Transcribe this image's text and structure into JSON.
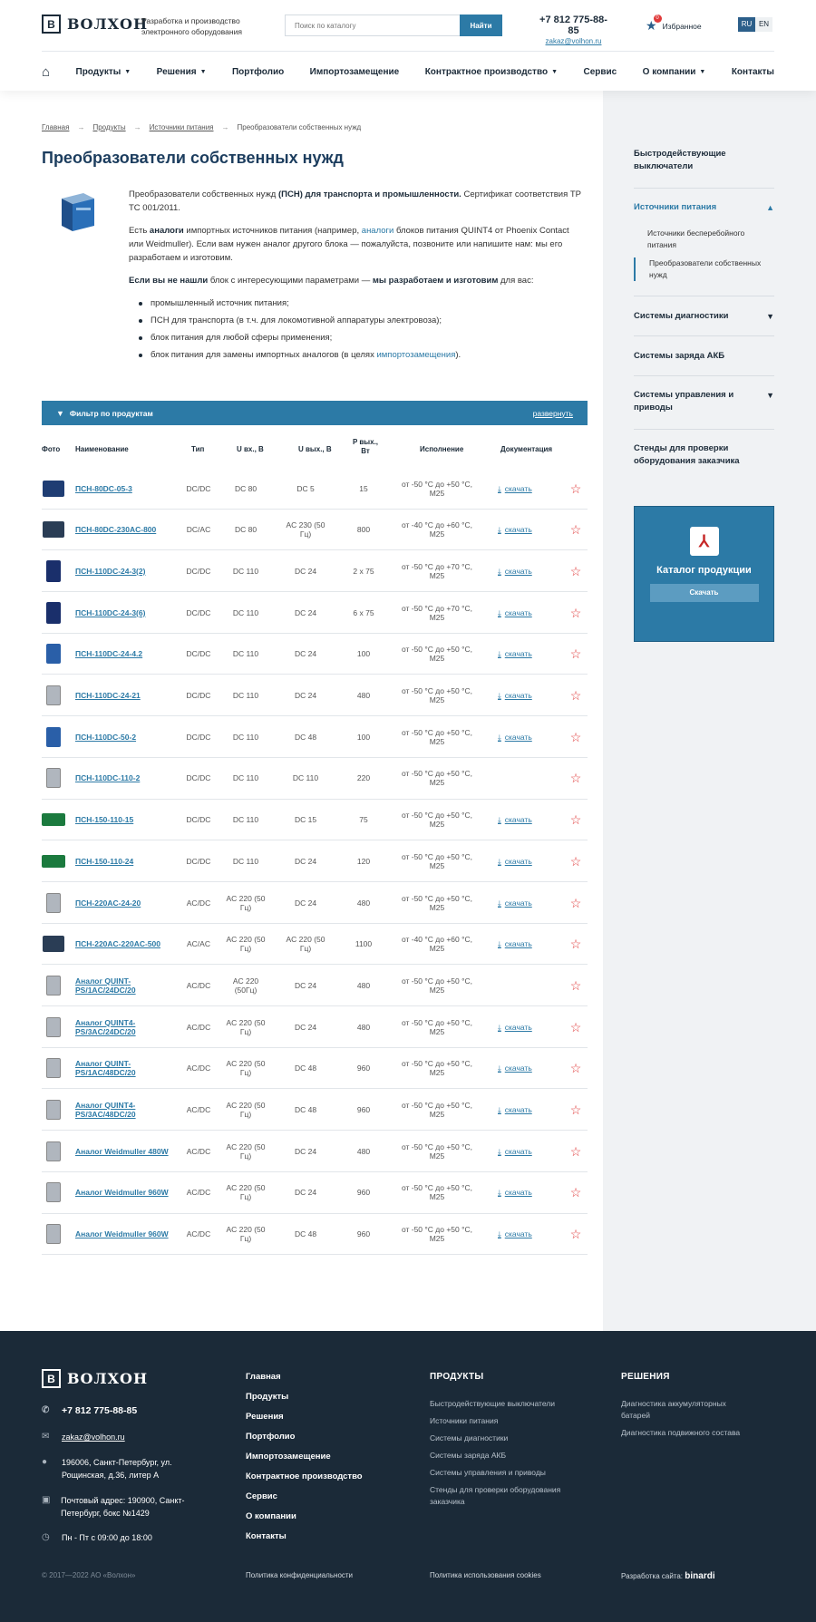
{
  "header": {
    "logo_mark": "В",
    "logo_text": "ВОЛХОН",
    "tagline": "Разработка и производство электронного оборудования",
    "search_placeholder": "Поиск по каталогу",
    "search_button": "Найти",
    "phone": "+7 812 775-88-85",
    "email": "zakaz@volhon.ru",
    "favorites_label": "Избранное",
    "favorites_count": "0",
    "lang_ru": "RU",
    "lang_en": "EN"
  },
  "nav": {
    "items": [
      "Продукты",
      "Решения",
      "Портфолио",
      "Импортозамещение",
      "Контрактное производство",
      "Сервис",
      "О компании",
      "Контакты"
    ]
  },
  "breadcrumb": {
    "items": [
      "Главная",
      "Продукты",
      "Источники питания",
      "Преобразователи собственных нужд"
    ]
  },
  "page": {
    "title": "Преобразователи собственных нужд",
    "p1_a": "Преобразователи собственных нужд ",
    "p1_b": "(ПСН) для транспорта и промышленности.",
    "p1_c": " Сертификат соответствия ТР ТС 001/2011.",
    "p2_a": "Есть ",
    "p2_b": "аналоги",
    "p2_c": " импортных источников питания (например, ",
    "p2_d": "аналоги",
    "p2_e": " блоков питания QUINT4 от Phoenix Contact или Weidmuller). Если вам нужен аналог другого блока — пожалуйста, позвоните или напишите нам: мы его разработаем и изготовим.",
    "p3_a": "Если вы не нашли",
    "p3_b": " блок с интересующими параметрами — ",
    "p3_c": "мы разработаем и изготовим",
    "p3_d": " для вас:",
    "bullets": [
      "промышленный источник питания;",
      "ПСН для транспорта (в т.ч. для локомотивной аппаратуры электровоза);",
      "блок питания для любой сферы применения;",
      "блок питания для замены импортных аналогов (в целях "
    ],
    "bullet4_link": "импортозамещения",
    "bullet4_end": ")."
  },
  "filter": {
    "label": "Фильтр по продуктам",
    "expand": "развернуть"
  },
  "table": {
    "headers": {
      "photo": "Фото",
      "name": "Наименование",
      "type": "Тип",
      "uin": "U вх., В",
      "uout": "U вых., В",
      "pw": "P вых., Вт",
      "exec": "Исполнение",
      "doc": "Документация"
    },
    "download_label": "скачать",
    "rows": [
      {
        "name": "ПСН-80DC-05-3",
        "type": "DC/DC",
        "uin": "DC 80",
        "uout": "DC 5",
        "pw": "15",
        "exec": "от -50 °C до +50 °C, M25",
        "doc": true,
        "img": "t-blk"
      },
      {
        "name": "ПСН-80DC-230AC-800",
        "type": "DC/AC",
        "uin": "DC 80",
        "uout": "AC 230 (50 Гц)",
        "pw": "800",
        "exec": "от -40 °C до +60 °C, M25",
        "doc": true,
        "img": "t-dark"
      },
      {
        "name": "ПСН-110DC-24-3(2)",
        "type": "DC/DC",
        "uin": "DC 110",
        "uout": "DC 24",
        "pw": "2 x 75",
        "exec": "от -50 °C до +70 °C, M25",
        "doc": true,
        "img": "t-navy"
      },
      {
        "name": "ПСН-110DC-24-3(6)",
        "type": "DC/DC",
        "uin": "DC 110",
        "uout": "DC 24",
        "pw": "6 x 75",
        "exec": "от -50 °C до +70 °C, M25",
        "doc": true,
        "img": "t-navy"
      },
      {
        "name": "ПСН-110DC-24-4.2",
        "type": "DC/DC",
        "uin": "DC 110",
        "uout": "DC 24",
        "pw": "100",
        "exec": "от -50 °C до +50 °C, M25",
        "doc": true,
        "img": "t-blue"
      },
      {
        "name": "ПСН-110DC-24-21",
        "type": "DC/DC",
        "uin": "DC 110",
        "uout": "DC 24",
        "pw": "480",
        "exec": "от -50 °C до +50 °C, M25",
        "doc": true,
        "img": "t-silver"
      },
      {
        "name": "ПСН-110DC-50-2",
        "type": "DC/DC",
        "uin": "DC 110",
        "uout": "DC 48",
        "pw": "100",
        "exec": "от -50 °C до +50 °C, M25",
        "doc": true,
        "img": "t-blue"
      },
      {
        "name": "ПСН-110DC-110-2",
        "type": "DC/DC",
        "uin": "DC 110",
        "uout": "DC 110",
        "pw": "220",
        "exec": "от -50 °C до +50 °C, M25",
        "doc": false,
        "img": "t-silver"
      },
      {
        "name": "ПСН-150-110-15",
        "type": "DC/DC",
        "uin": "DC 110",
        "uout": "DC 15",
        "pw": "75",
        "exec": "от -50 °C до +50 °C, M25",
        "doc": true,
        "img": "t-green"
      },
      {
        "name": "ПСН-150-110-24",
        "type": "DC/DC",
        "uin": "DC 110",
        "uout": "DC 24",
        "pw": "120",
        "exec": "от -50 °C до +50 °C, M25",
        "doc": true,
        "img": "t-green"
      },
      {
        "name": "ПСН-220AC-24-20",
        "type": "AC/DC",
        "uin": "AC 220 (50 Гц)",
        "uout": "DC 24",
        "pw": "480",
        "exec": "от -50 °C до +50 °C, M25",
        "doc": true,
        "img": "t-silver"
      },
      {
        "name": "ПСН-220AC-220AC-500",
        "type": "AC/AC",
        "uin": "AC 220 (50 Гц)",
        "uout": "AC 220 (50 Гц)",
        "pw": "1100",
        "exec": "от -40 °C до +60 °C, M25",
        "doc": true,
        "img": "t-dark"
      },
      {
        "name": "Аналог QUINT-PS/1AC/24DC/20",
        "type": "AC/DC",
        "uin": "AC 220 (50Гц)",
        "uout": "DC 24",
        "pw": "480",
        "exec": "от -50 °C до +50 °C, M25",
        "doc": false,
        "img": "t-silver"
      },
      {
        "name": "Аналог QUINT4-PS/3AC/24DC/20",
        "type": "AC/DC",
        "uin": "AC 220 (50 Гц)",
        "uout": "DC 24",
        "pw": "480",
        "exec": "от -50 °C до +50 °C, M25",
        "doc": true,
        "img": "t-silver"
      },
      {
        "name": "Аналог QUINT-PS/1AC/48DC/20",
        "type": "AC/DC",
        "uin": "AC 220 (50 Гц)",
        "uout": "DC 48",
        "pw": "960",
        "exec": "от -50 °C до +50 °C, M25",
        "doc": true,
        "img": "t-silver"
      },
      {
        "name": "Аналог QUINT4-PS/3AC/48DC/20",
        "type": "AC/DC",
        "uin": "AC 220 (50 Гц)",
        "uout": "DC 48",
        "pw": "960",
        "exec": "от -50 °C до +50 °C, M25",
        "doc": true,
        "img": "t-silver"
      },
      {
        "name": "Аналог Weidmuller 480W",
        "type": "AC/DC",
        "uin": "AC 220 (50 Гц)",
        "uout": "DC 24",
        "pw": "480",
        "exec": "от -50 °C до +50 °C, M25",
        "doc": true,
        "img": "t-silver"
      },
      {
        "name": "Аналог Weidmuller 960W",
        "type": "AC/DC",
        "uin": "AC 220 (50 Гц)",
        "uout": "DC 24",
        "pw": "960",
        "exec": "от -50 °C до +50 °C, M25",
        "doc": true,
        "img": "t-silver"
      },
      {
        "name": "Аналог Weidmuller 960W",
        "type": "AC/DC",
        "uin": "AC 220 (50 Гц)",
        "uout": "DC 48",
        "pw": "960",
        "exec": "от -50 °C до +50 °C, M25",
        "doc": true,
        "img": "t-silver"
      }
    ]
  },
  "sidebar": {
    "items": [
      "Быстродействующие выключатели",
      "Источники питания",
      "Системы диагностики",
      "Системы заряда АКБ",
      "Системы управления и приводы",
      "Стенды для проверки оборудования заказчика"
    ],
    "sub": [
      "Источники бесперебойного питания",
      "Преобразователи собственных нужд"
    ]
  },
  "catalog": {
    "icon": "pdf-icon",
    "title": "Каталог продукции",
    "button": "Скачать"
  },
  "footer": {
    "phone": "+7 812 775-88-85",
    "email": "zakaz@volhon.ru",
    "address": "196006, Санкт-Петербург, ул. Рощинская, д.36, литер А",
    "postal": "Почтовый адрес: 190900, Санкт-Петербург, бокс №1429",
    "hours": "Пн - Пт с 09:00 до 18:00",
    "menu": [
      "Главная",
      "Продукты",
      "Решения",
      "Портфолио",
      "Импортозамещение",
      "Контрактное производство",
      "Сервис",
      "О компании",
      "Контакты"
    ],
    "products_title": "ПРОДУКТЫ",
    "products": [
      "Быстродействующие выключатели",
      "Источники питания",
      "Системы диагностики",
      "Системы заряда АКБ",
      "Системы управления и приводы",
      "Стенды для проверки оборудования заказчика"
    ],
    "solutions_title": "РЕШЕНИЯ",
    "solutions": [
      "Диагностика аккумуляторных батарей",
      "Диагностика подвижного состава"
    ],
    "copyright": "© 2017—2022 АО «Волхон»",
    "privacy": "Политика конфиденциальности",
    "cookies": "Политика использования cookies",
    "dev_label": "Разработка сайта:",
    "dev_brand": "binardi"
  }
}
